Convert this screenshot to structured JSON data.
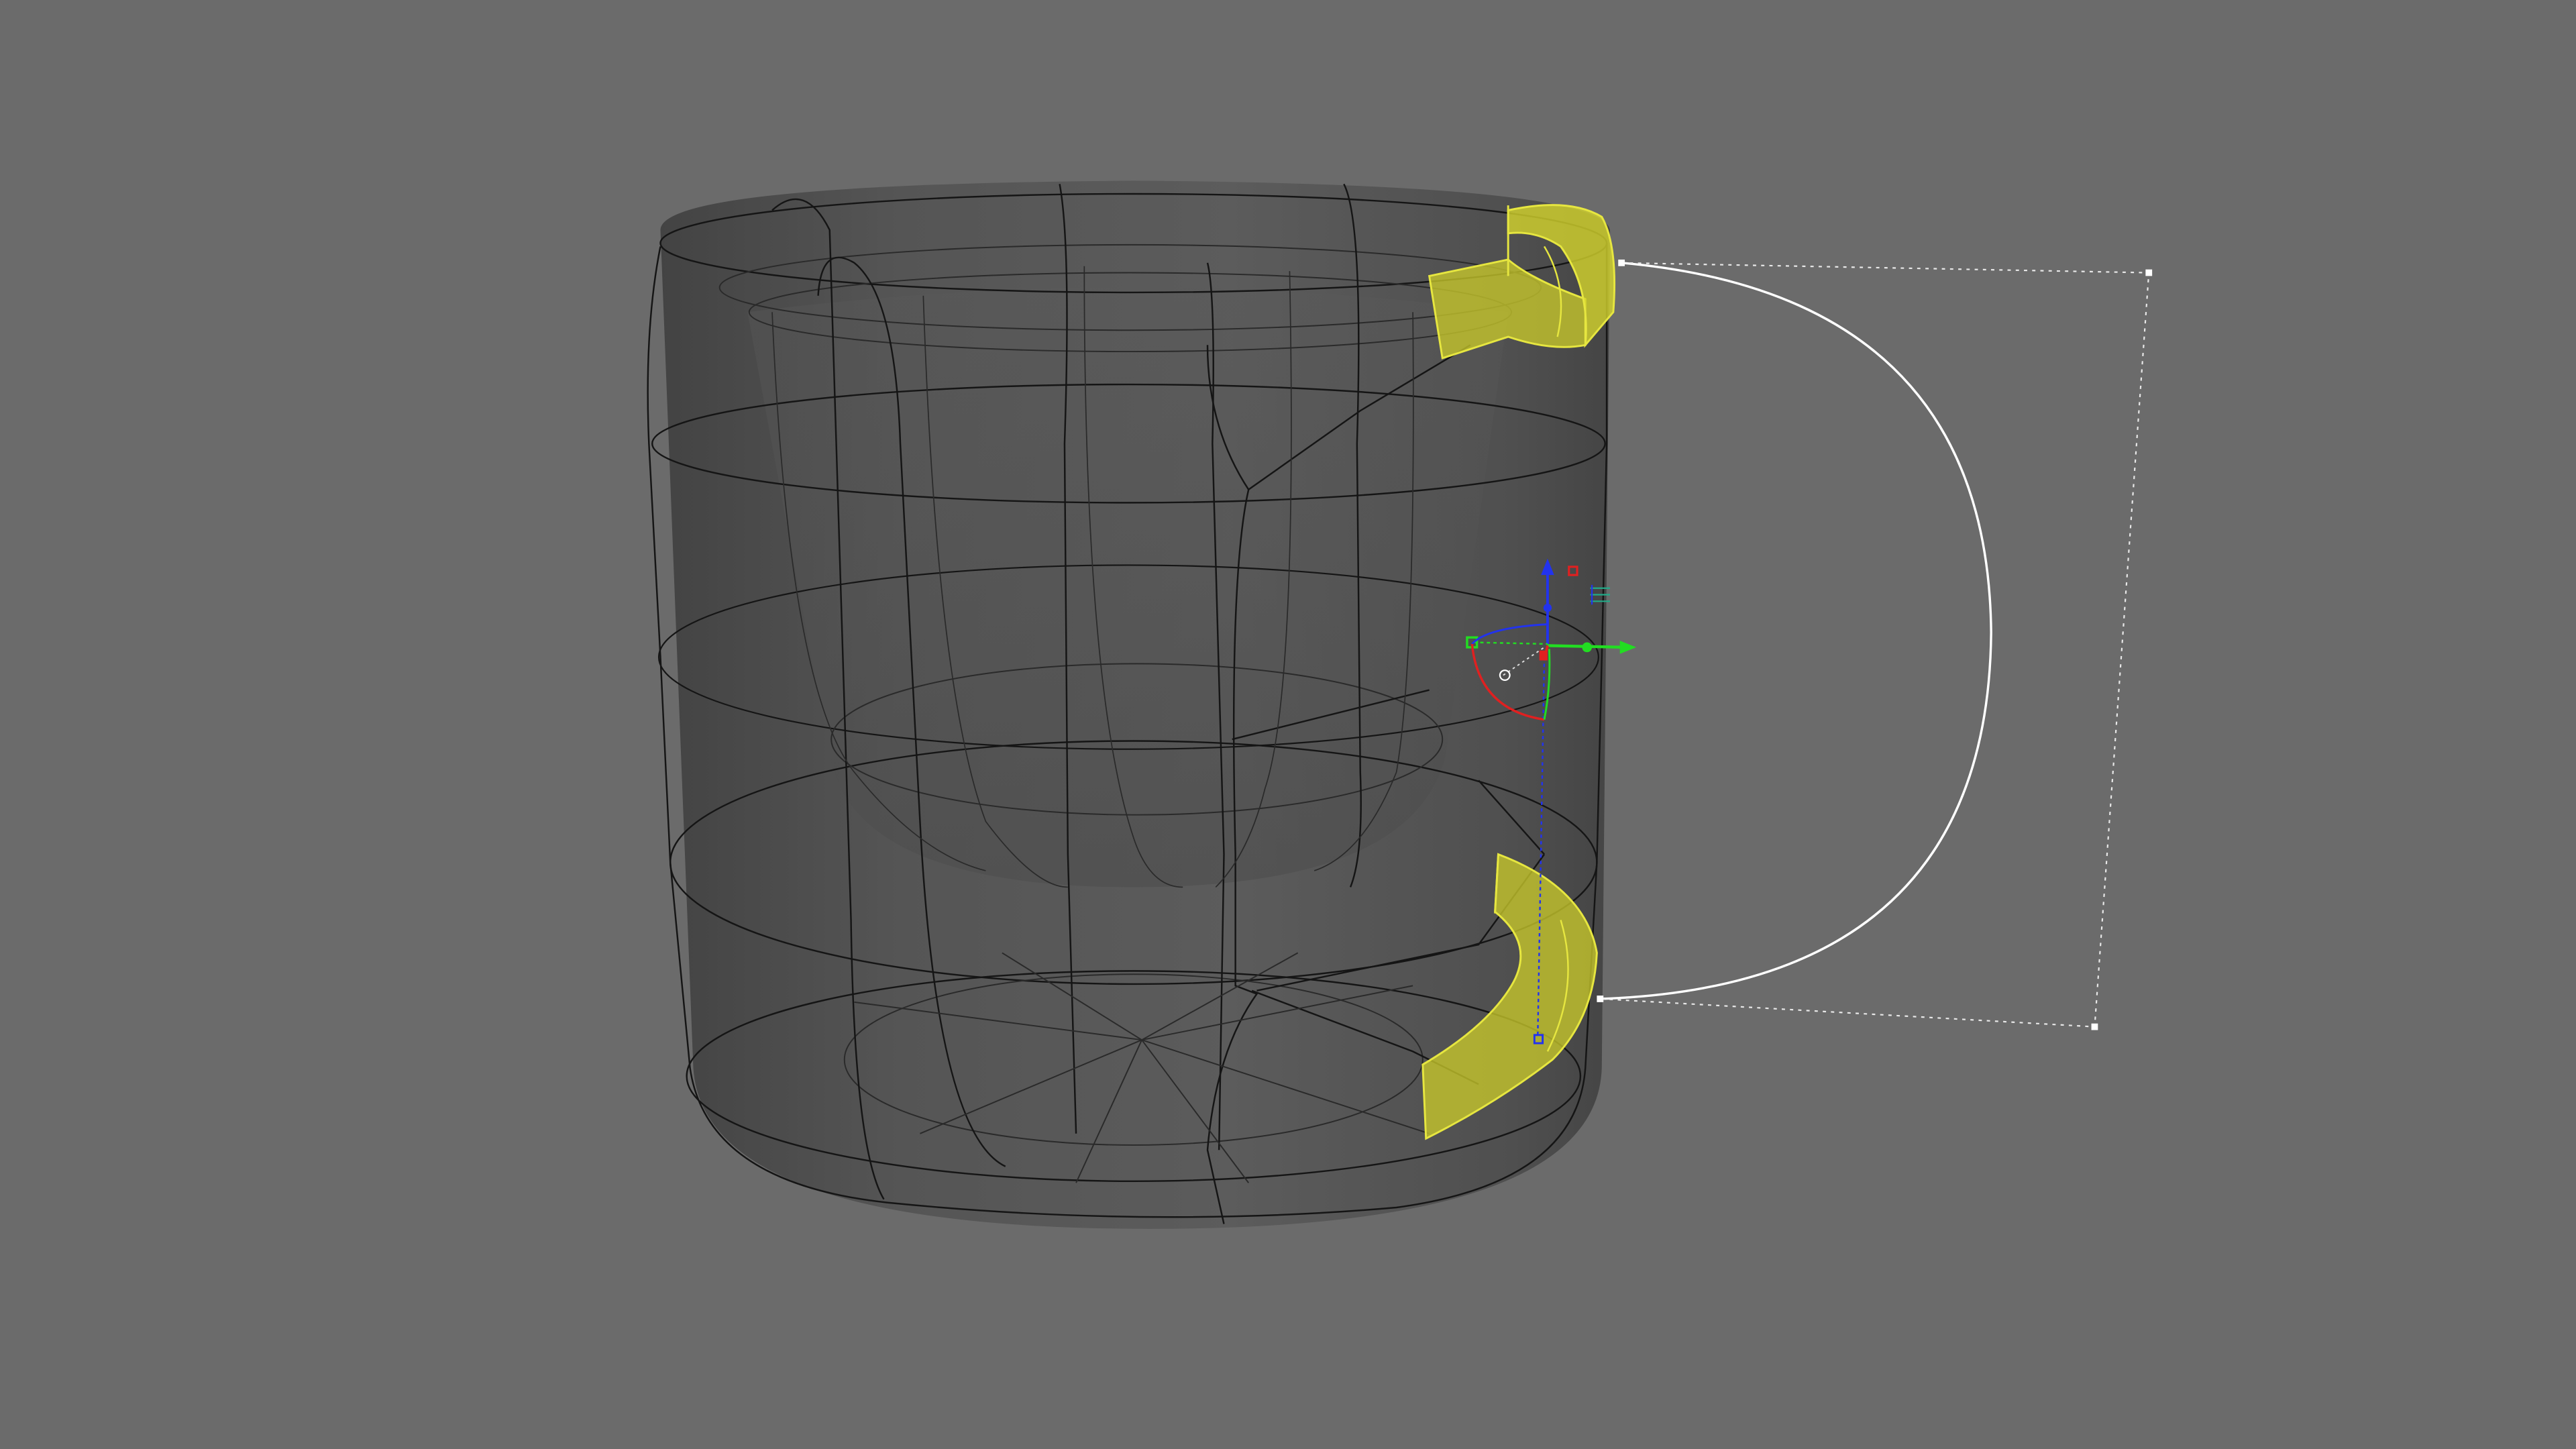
{
  "viewport": {
    "background": "#6b6b6b",
    "accent_selection": "#d9d92a",
    "wire_color": "#111111",
    "curve_color": "#ffffff"
  },
  "scene": {
    "object": "mug-body",
    "selected_faces": [
      "handle-attach-top-face",
      "handle-attach-bottom-face"
    ],
    "sketch_curve": "handle-profile-curve"
  },
  "gizmo": {
    "axes": [
      {
        "name": "x-axis",
        "color": "#e02020"
      },
      {
        "name": "y-axis",
        "color": "#22dd22"
      },
      {
        "name": "z-axis",
        "color": "#2233ee"
      }
    ]
  }
}
